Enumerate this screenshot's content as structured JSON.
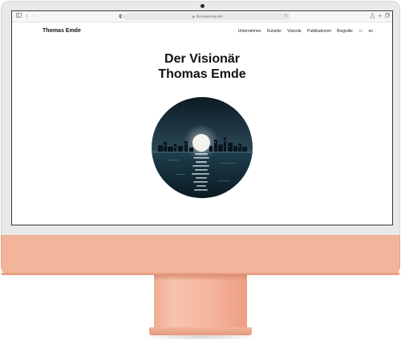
{
  "browser": {
    "url": "thomasemde.de",
    "icons": {
      "sidebar": "sidebar-icon",
      "back": "chevron-left-icon",
      "forward": "chevron-right-icon",
      "shield": "privacy-shield-icon",
      "lock": "lock-icon",
      "reload": "reload-icon",
      "share": "share-icon",
      "new_tab": "plus-icon",
      "tabs": "tabs-overview-icon"
    }
  },
  "site": {
    "logo": "Thomas Emde",
    "nav": [
      {
        "label": "Unternehmer"
      },
      {
        "label": "Künstler"
      },
      {
        "label": "Visionär"
      },
      {
        "label": "Publikationen"
      },
      {
        "label": "Biografie"
      }
    ],
    "languages": [
      {
        "label": "de",
        "active": false
      },
      {
        "label": "en",
        "active": true
      }
    ]
  },
  "hero": {
    "title_line1": "Der Visionär",
    "title_line2": "Thomas Emde",
    "image": "moon-over-city-skyline-at-night"
  },
  "device": {
    "chin_color": "#f2b49b",
    "stand_color": "#f4b8a0",
    "bezel_color": "#e9e9e9"
  }
}
